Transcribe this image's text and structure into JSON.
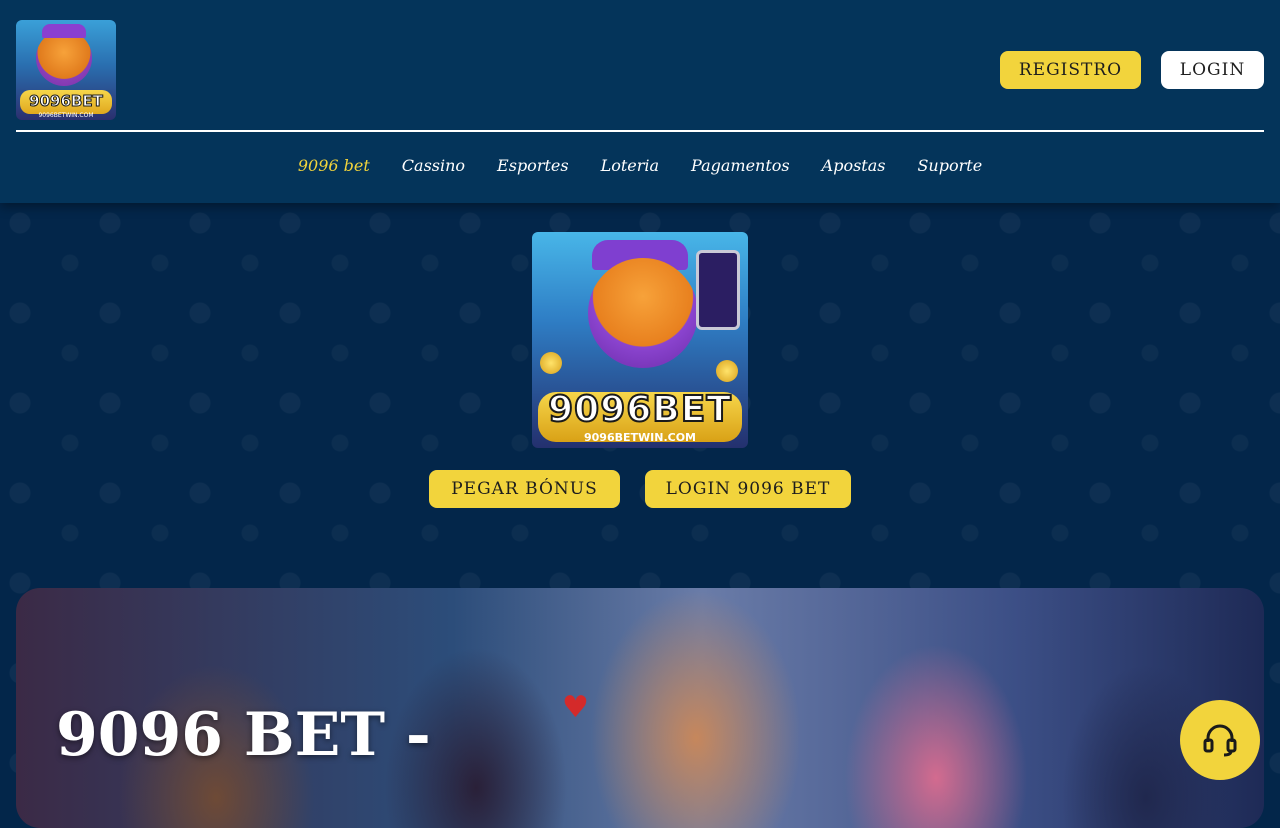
{
  "header": {
    "logo": {
      "brand": "9096BET",
      "domain": "9096BETWIN.COM"
    },
    "register_label": "REGISTRO",
    "login_label": "LOGIN"
  },
  "nav": {
    "items": [
      {
        "label": "9096 bet",
        "active": true
      },
      {
        "label": "Cassino"
      },
      {
        "label": "Esportes"
      },
      {
        "label": "Loteria"
      },
      {
        "label": "Pagamentos"
      },
      {
        "label": "Apostas"
      },
      {
        "label": "Suporte"
      }
    ]
  },
  "hero": {
    "logo": {
      "brand": "9096BET",
      "domain": "9096BETWIN.COM"
    },
    "bonus_label": "PEGAR BÓNUS",
    "login_label": "LOGIN 9096 BET"
  },
  "banner": {
    "title": "9096 BET -"
  },
  "support": {
    "icon": "headset-icon"
  },
  "colors": {
    "header_bg": "#04345a",
    "page_bg": "#03264a",
    "accent_yellow": "#f2d43c",
    "white": "#ffffff"
  }
}
